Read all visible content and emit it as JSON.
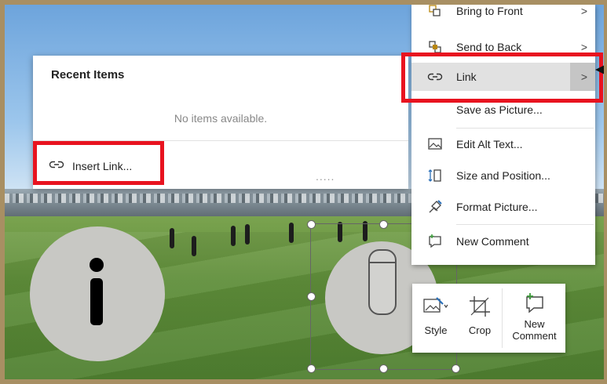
{
  "colors": {
    "highlight_red": "#e8131f",
    "menu_hover": "#e1e1e1",
    "accent_green": "#3c9a3a",
    "frame": "#a88f63"
  },
  "context_menu": {
    "items": [
      {
        "label": "Bring to Front",
        "icon": "bring-to-front-icon",
        "submenu": true
      },
      {
        "label": "Send to Back",
        "icon": "send-to-back-icon",
        "submenu": true
      },
      {
        "label": "Link",
        "icon": "link-icon",
        "submenu": true,
        "highlighted": true
      },
      {
        "label": "Save as Picture...",
        "icon": "",
        "submenu": false
      },
      {
        "label": "Edit Alt Text...",
        "icon": "alt-text-icon",
        "submenu": false
      },
      {
        "label": "Size and Position...",
        "icon": "size-position-icon",
        "submenu": false
      },
      {
        "label": "Format Picture...",
        "icon": "format-picture-icon",
        "submenu": false
      },
      {
        "label": "New Comment",
        "icon": "new-comment-icon",
        "submenu": false
      }
    ]
  },
  "link_submenu": {
    "title": "Recent Items",
    "empty_text": "No items available.",
    "insert_link_label": "Insert Link...",
    "more_indicator": "....."
  },
  "mini_toolbar": {
    "buttons": [
      {
        "label": "Style",
        "icon": "style-icon"
      },
      {
        "label": "Crop",
        "icon": "crop-icon"
      },
      {
        "label": "New Comment",
        "icon": "new-comment-icon"
      }
    ]
  }
}
